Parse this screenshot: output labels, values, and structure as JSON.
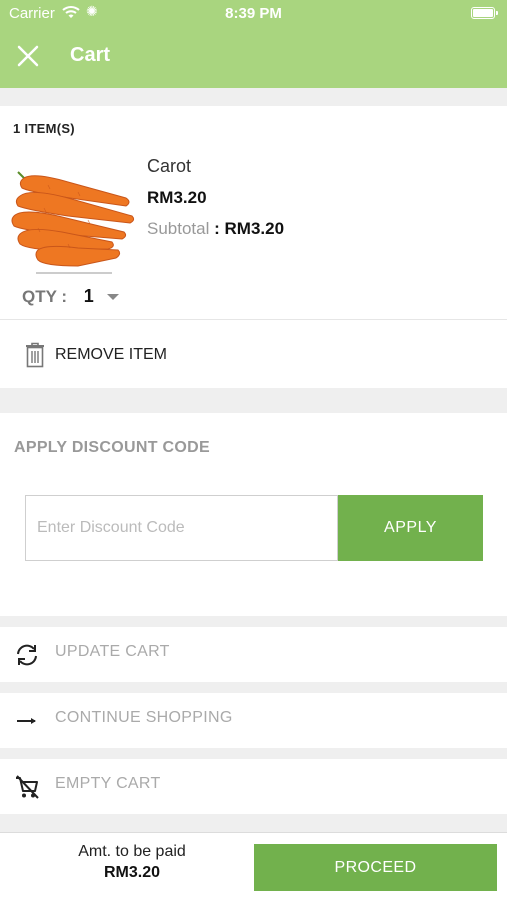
{
  "status_bar": {
    "carrier": "Carrier",
    "time": "8:39 PM"
  },
  "navbar": {
    "title": "Cart",
    "close_icon": "close-icon"
  },
  "cart": {
    "item_count": "1 ITEM(S)",
    "items": [
      {
        "name": "Carot",
        "price": "RM3.20",
        "subtotal_label": "Subtotal",
        "subtotal_colon": ":",
        "subtotal_value": "RM3.20",
        "qty_label": "QTY :",
        "qty_value": "1",
        "image_icon": "carrot-photo"
      }
    ],
    "remove_label": "REMOVE ITEM"
  },
  "discount": {
    "title": "APPLY DISCOUNT CODE",
    "placeholder": "Enter Discount Code",
    "apply_label": "APPLY"
  },
  "actions": {
    "update_cart": "UPDATE CART",
    "continue_shopping": "CONTINUE SHOPPING",
    "empty_cart": "EMPTY CART"
  },
  "footer": {
    "amount_label": "Amt. to be paid",
    "amount_value": "RM3.20",
    "proceed_label": "PROCEED"
  },
  "colors": {
    "header_green": "#a9d57f",
    "button_green": "#72b14d",
    "background": "#efefef"
  }
}
